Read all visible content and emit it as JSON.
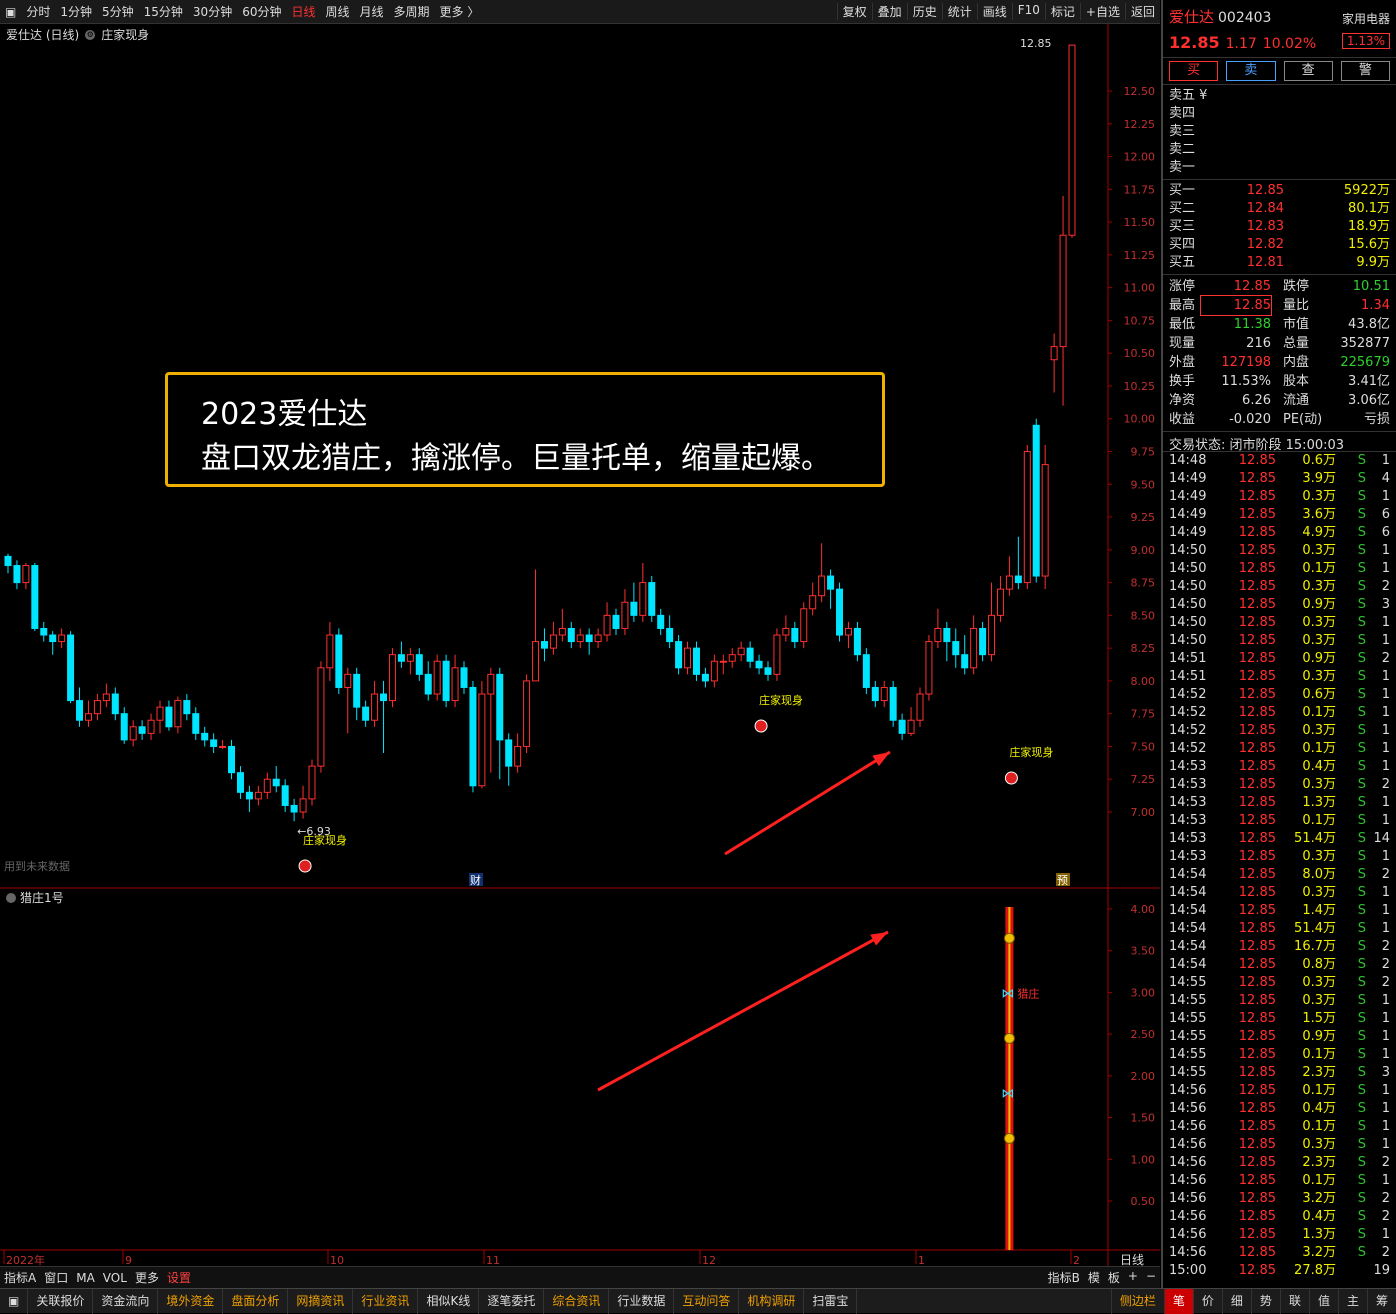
{
  "toolbar": {
    "items": [
      "分时",
      "1分钟",
      "5分钟",
      "15分钟",
      "30分钟",
      "60分钟",
      "日线",
      "周线",
      "月线",
      "多周期",
      "更多 〉"
    ],
    "right": [
      "复权",
      "叠加",
      "历史",
      "统计",
      "画线",
      "F10",
      "标记",
      "+自选",
      "返回"
    ]
  },
  "legend": {
    "title": "爱仕达 (日线)",
    "indicator": "庄家现身"
  },
  "annotation": {
    "line1": "2023爱仕达",
    "line2": "盘口双龙猎庄，擒涨停。巨量托单，缩量起爆。"
  },
  "price_axis": [
    "12.50",
    "12.25",
    "12.00",
    "11.75",
    "11.50",
    "11.25",
    "11.00",
    "10.75",
    "10.50",
    "10.25",
    "10.00",
    "9.75",
    "9.50",
    "9.25",
    "9.00",
    "8.75",
    "8.50",
    "8.25",
    "8.00",
    "7.75",
    "7.50",
    "7.25",
    "7.00"
  ],
  "ind_axis": [
    "4.00",
    "3.50",
    "3.00",
    "2.50",
    "2.00",
    "1.50",
    "1.00",
    "0.50"
  ],
  "date_axis": [
    "2022年",
    "9",
    "10",
    "11",
    "12",
    "1",
    "2"
  ],
  "period_label": "日线",
  "marks": {
    "high": "12.85",
    "low": "←6.93",
    "zhuang": "庄家现身",
    "future": "用到未来数据",
    "cai": "财",
    "yu": "预",
    "liezhuang": "猎庄"
  },
  "sub_legend": "猎庄1号",
  "bottom": {
    "left": [
      "指标A",
      "窗口",
      "MA",
      "VOL",
      "更多"
    ],
    "settings": "设置",
    "right": [
      "指标B",
      "模",
      "板",
      "+",
      "−"
    ]
  },
  "taskbar": {
    "items": [
      "关联报价",
      "资金流向",
      "境外资金",
      "盘面分析",
      "网摘资讯",
      "行业资讯",
      "相似K线",
      "逐笔委托",
      "综合资讯",
      "行业数据",
      "互动问答",
      "机构调研",
      "扫雷宝"
    ],
    "gold": [
      2,
      3,
      4,
      5,
      8,
      10,
      11
    ],
    "side": "侧边栏",
    "tabs": [
      "笔",
      "价",
      "细",
      "势",
      "联",
      "值",
      "主",
      "筹"
    ]
  },
  "stock": {
    "name": "爱仕达",
    "code": "002403",
    "industry": "家用电器",
    "price": "12.85",
    "change": "1.17",
    "pct": "10.02%",
    "tag": "1.13%"
  },
  "buttons": [
    "买",
    "卖",
    "查",
    "警"
  ],
  "asks": [
    [
      "卖五 ¥",
      "",
      ""
    ],
    [
      "卖四",
      "",
      ""
    ],
    [
      "卖三",
      "",
      ""
    ],
    [
      "卖二",
      "",
      ""
    ],
    [
      "卖一",
      "",
      ""
    ]
  ],
  "bids": [
    [
      "买一",
      "12.85",
      "5922万"
    ],
    [
      "买二",
      "12.84",
      "80.1万"
    ],
    [
      "买三",
      "12.83",
      "18.9万"
    ],
    [
      "买四",
      "12.82",
      "15.6万"
    ],
    [
      "买五",
      "12.81",
      "9.9万"
    ]
  ],
  "stats": [
    [
      "涨停",
      "12.85",
      "跌停",
      "10.51"
    ],
    [
      "最高",
      "12.85",
      "量比",
      "1.34"
    ],
    [
      "最低",
      "11.38",
      "市值",
      "43.8亿"
    ],
    [
      "现量",
      "216",
      "总量",
      "352877"
    ],
    [
      "外盘",
      "127198",
      "内盘",
      "225679"
    ],
    [
      "换手",
      "11.53%",
      "股本",
      "3.41亿"
    ],
    [
      "净资",
      "6.26",
      "流通",
      "3.06亿"
    ],
    [
      "收益",
      "-0.020",
      "PE(动)",
      "亏损"
    ]
  ],
  "state": "交易状态: 闭市阶段 15:00:03",
  "ticks": [
    [
      "14:48",
      "12.85",
      "0.6万",
      "S",
      "1"
    ],
    [
      "14:49",
      "12.85",
      "3.9万",
      "S",
      "4"
    ],
    [
      "14:49",
      "12.85",
      "0.3万",
      "S",
      "1"
    ],
    [
      "14:49",
      "12.85",
      "3.6万",
      "S",
      "6"
    ],
    [
      "14:49",
      "12.85",
      "4.9万",
      "S",
      "6"
    ],
    [
      "14:50",
      "12.85",
      "0.3万",
      "S",
      "1"
    ],
    [
      "14:50",
      "12.85",
      "0.1万",
      "S",
      "1"
    ],
    [
      "14:50",
      "12.85",
      "0.3万",
      "S",
      "2"
    ],
    [
      "14:50",
      "12.85",
      "0.9万",
      "S",
      "3"
    ],
    [
      "14:50",
      "12.85",
      "0.3万",
      "S",
      "1"
    ],
    [
      "14:50",
      "12.85",
      "0.3万",
      "S",
      "1"
    ],
    [
      "14:51",
      "12.85",
      "0.9万",
      "S",
      "2"
    ],
    [
      "14:51",
      "12.85",
      "0.3万",
      "S",
      "1"
    ],
    [
      "14:52",
      "12.85",
      "0.6万",
      "S",
      "1"
    ],
    [
      "14:52",
      "12.85",
      "0.1万",
      "S",
      "1"
    ],
    [
      "14:52",
      "12.85",
      "0.3万",
      "S",
      "1"
    ],
    [
      "14:52",
      "12.85",
      "0.1万",
      "S",
      "1"
    ],
    [
      "14:53",
      "12.85",
      "0.4万",
      "S",
      "1"
    ],
    [
      "14:53",
      "12.85",
      "0.3万",
      "S",
      "2"
    ],
    [
      "14:53",
      "12.85",
      "1.3万",
      "S",
      "1"
    ],
    [
      "14:53",
      "12.85",
      "0.1万",
      "S",
      "1"
    ],
    [
      "14:53",
      "12.85",
      "51.4万",
      "S",
      "14"
    ],
    [
      "14:53",
      "12.85",
      "0.3万",
      "S",
      "1"
    ],
    [
      "14:54",
      "12.85",
      "8.0万",
      "S",
      "2"
    ],
    [
      "14:54",
      "12.85",
      "0.3万",
      "S",
      "1"
    ],
    [
      "14:54",
      "12.85",
      "1.4万",
      "S",
      "1"
    ],
    [
      "14:54",
      "12.85",
      "51.4万",
      "S",
      "1"
    ],
    [
      "14:54",
      "12.85",
      "16.7万",
      "S",
      "2"
    ],
    [
      "14:54",
      "12.85",
      "0.8万",
      "S",
      "2"
    ],
    [
      "14:55",
      "12.85",
      "0.3万",
      "S",
      "2"
    ],
    [
      "14:55",
      "12.85",
      "0.3万",
      "S",
      "1"
    ],
    [
      "14:55",
      "12.85",
      "1.5万",
      "S",
      "1"
    ],
    [
      "14:55",
      "12.85",
      "0.9万",
      "S",
      "1"
    ],
    [
      "14:55",
      "12.85",
      "0.1万",
      "S",
      "1"
    ],
    [
      "14:55",
      "12.85",
      "2.3万",
      "S",
      "3"
    ],
    [
      "14:56",
      "12.85",
      "0.1万",
      "S",
      "1"
    ],
    [
      "14:56",
      "12.85",
      "0.4万",
      "S",
      "1"
    ],
    [
      "14:56",
      "12.85",
      "0.1万",
      "S",
      "1"
    ],
    [
      "14:56",
      "12.85",
      "0.3万",
      "S",
      "1"
    ],
    [
      "14:56",
      "12.85",
      "2.3万",
      "S",
      "2"
    ],
    [
      "14:56",
      "12.85",
      "0.1万",
      "S",
      "1"
    ],
    [
      "14:56",
      "12.85",
      "3.2万",
      "S",
      "2"
    ],
    [
      "14:56",
      "12.85",
      "0.4万",
      "S",
      "2"
    ],
    [
      "14:56",
      "12.85",
      "1.3万",
      "S",
      "1"
    ],
    [
      "14:56",
      "12.85",
      "3.2万",
      "S",
      "2"
    ],
    [
      "15:00",
      "12.85",
      "27.8万",
      "",
      "19"
    ]
  ],
  "chart_data": {
    "type": "candlestick",
    "candles": [
      [
        8.95,
        8.88,
        8.97,
        8.82
      ],
      [
        8.88,
        8.75,
        8.92,
        8.7
      ],
      [
        8.75,
        8.88,
        8.9,
        8.7
      ],
      [
        8.88,
        8.4,
        8.9,
        8.38
      ],
      [
        8.4,
        8.35,
        8.45,
        8.3
      ],
      [
        8.35,
        8.3,
        8.38,
        8.2
      ],
      [
        8.3,
        8.35,
        8.4,
        8.25
      ],
      [
        8.35,
        7.85,
        8.38,
        7.83
      ],
      [
        7.85,
        7.7,
        7.95,
        7.65
      ],
      [
        7.7,
        7.75,
        7.85,
        7.65
      ],
      [
        7.75,
        7.85,
        7.9,
        7.7
      ],
      [
        7.85,
        7.9,
        7.98,
        7.8
      ],
      [
        7.9,
        7.75,
        7.95,
        7.7
      ],
      [
        7.75,
        7.55,
        7.8,
        7.52
      ],
      [
        7.55,
        7.65,
        7.7,
        7.5
      ],
      [
        7.65,
        7.6,
        7.7,
        7.55
      ],
      [
        7.6,
        7.7,
        7.75,
        7.55
      ],
      [
        7.7,
        7.8,
        7.85,
        7.6
      ],
      [
        7.8,
        7.65,
        7.85,
        7.62
      ],
      [
        7.65,
        7.85,
        7.88,
        7.6
      ],
      [
        7.85,
        7.75,
        7.9,
        7.7
      ],
      [
        7.75,
        7.6,
        7.8,
        7.55
      ],
      [
        7.6,
        7.55,
        7.65,
        7.5
      ],
      [
        7.55,
        7.5,
        7.6,
        7.45
      ],
      [
        7.5,
        7.5,
        7.55,
        7.48
      ],
      [
        7.5,
        7.3,
        7.55,
        7.25
      ],
      [
        7.3,
        7.15,
        7.35,
        7.1
      ],
      [
        7.15,
        7.1,
        7.2,
        7.0
      ],
      [
        7.1,
        7.15,
        7.2,
        7.05
      ],
      [
        7.15,
        7.25,
        7.3,
        7.1
      ],
      [
        7.25,
        7.2,
        7.35,
        7.15
      ],
      [
        7.2,
        7.05,
        7.25,
        7.0
      ],
      [
        7.05,
        7.0,
        7.1,
        6.93
      ],
      [
        7.0,
        7.1,
        7.2,
        6.95
      ],
      [
        7.1,
        7.35,
        7.4,
        7.05
      ],
      [
        7.35,
        8.1,
        8.15,
        7.3
      ],
      [
        8.1,
        8.35,
        8.45,
        8.0
      ],
      [
        8.35,
        7.95,
        8.4,
        7.9
      ],
      [
        7.95,
        8.05,
        8.1,
        7.6
      ],
      [
        8.05,
        7.8,
        8.1,
        7.7
      ],
      [
        7.8,
        7.7,
        7.85,
        7.65
      ],
      [
        7.7,
        7.9,
        8.0,
        7.65
      ],
      [
        7.9,
        7.85,
        8.0,
        7.45
      ],
      [
        7.85,
        8.2,
        8.25,
        7.8
      ],
      [
        8.2,
        8.15,
        8.3,
        8.1
      ],
      [
        8.15,
        8.2,
        8.25,
        8.05
      ],
      [
        8.2,
        8.05,
        8.25,
        8.0
      ],
      [
        8.05,
        7.9,
        8.15,
        7.85
      ],
      [
        7.9,
        8.15,
        8.2,
        7.85
      ],
      [
        8.15,
        7.85,
        8.2,
        7.8
      ],
      [
        7.85,
        8.1,
        8.2,
        7.8
      ],
      [
        8.1,
        7.95,
        8.15,
        7.9
      ],
      [
        7.95,
        7.2,
        8.0,
        7.15
      ],
      [
        7.2,
        7.9,
        8.0,
        7.18
      ],
      [
        7.9,
        8.05,
        8.1,
        7.3
      ],
      [
        8.05,
        7.55,
        8.1,
        7.25
      ],
      [
        7.55,
        7.35,
        7.6,
        7.2
      ],
      [
        7.35,
        7.5,
        7.6,
        7.3
      ],
      [
        7.5,
        8.0,
        8.05,
        7.45
      ],
      [
        8.0,
        8.3,
        8.85,
        8.2
      ],
      [
        8.3,
        8.25,
        8.4,
        8.15
      ],
      [
        8.25,
        8.35,
        8.45,
        8.2
      ],
      [
        8.35,
        8.4,
        8.55,
        8.3
      ],
      [
        8.4,
        8.3,
        8.45,
        8.25
      ],
      [
        8.3,
        8.35,
        8.4,
        8.25
      ],
      [
        8.35,
        8.3,
        8.4,
        8.2
      ],
      [
        8.3,
        8.35,
        8.4,
        8.25
      ],
      [
        8.35,
        8.5,
        8.6,
        8.3
      ],
      [
        8.5,
        8.4,
        8.55,
        8.35
      ],
      [
        8.4,
        8.6,
        8.7,
        8.35
      ],
      [
        8.6,
        8.5,
        8.75,
        8.45
      ],
      [
        8.5,
        8.75,
        8.9,
        8.45
      ],
      [
        8.75,
        8.5,
        8.8,
        8.45
      ],
      [
        8.5,
        8.4,
        8.55,
        8.35
      ],
      [
        8.4,
        8.3,
        8.5,
        8.25
      ],
      [
        8.3,
        8.1,
        8.35,
        8.05
      ],
      [
        8.1,
        8.25,
        8.3,
        8.05
      ],
      [
        8.25,
        8.05,
        8.3,
        8.0
      ],
      [
        8.05,
        8.0,
        8.1,
        7.95
      ],
      [
        8.0,
        8.15,
        8.2,
        7.95
      ],
      [
        8.15,
        8.15,
        8.2,
        8.05
      ],
      [
        8.15,
        8.2,
        8.25,
        8.1
      ],
      [
        8.2,
        8.25,
        8.3,
        8.15
      ],
      [
        8.25,
        8.15,
        8.3,
        8.1
      ],
      [
        8.15,
        8.1,
        8.2,
        8.05
      ],
      [
        8.1,
        8.05,
        8.15,
        8.0
      ],
      [
        8.05,
        8.35,
        8.4,
        8.0
      ],
      [
        8.35,
        8.4,
        8.5,
        8.3
      ],
      [
        8.4,
        8.3,
        8.45,
        8.25
      ],
      [
        8.3,
        8.55,
        8.6,
        8.25
      ],
      [
        8.55,
        8.65,
        8.75,
        8.5
      ],
      [
        8.65,
        8.8,
        9.05,
        8.6
      ],
      [
        8.8,
        8.7,
        8.85,
        8.55
      ],
      [
        8.7,
        8.35,
        8.75,
        8.3
      ],
      [
        8.35,
        8.4,
        8.45,
        8.25
      ],
      [
        8.4,
        8.2,
        8.45,
        8.15
      ],
      [
        8.2,
        7.95,
        8.25,
        7.9
      ],
      [
        7.95,
        7.85,
        8.0,
        7.8
      ],
      [
        7.85,
        7.95,
        8.0,
        7.8
      ],
      [
        7.95,
        7.7,
        8.0,
        7.65
      ],
      [
        7.7,
        7.6,
        7.75,
        7.55
      ],
      [
        7.6,
        7.7,
        7.8,
        7.58
      ],
      [
        7.7,
        7.9,
        7.95,
        7.65
      ],
      [
        7.9,
        8.3,
        8.35,
        7.85
      ],
      [
        8.3,
        8.4,
        8.55,
        8.25
      ],
      [
        8.4,
        8.3,
        8.45,
        8.15
      ],
      [
        8.3,
        8.2,
        8.4,
        8.1
      ],
      [
        8.2,
        8.1,
        8.35,
        8.05
      ],
      [
        8.1,
        8.4,
        8.5,
        8.05
      ],
      [
        8.4,
        8.2,
        8.45,
        8.15
      ],
      [
        8.2,
        8.5,
        8.75,
        8.15
      ],
      [
        8.5,
        8.7,
        8.8,
        8.45
      ],
      [
        8.7,
        8.8,
        8.95,
        8.65
      ],
      [
        8.8,
        8.75,
        9.1,
        8.7
      ],
      [
        8.75,
        9.75,
        9.8,
        8.7
      ],
      [
        9.95,
        8.8,
        10.0,
        8.75
      ],
      [
        8.8,
        9.65,
        9.8,
        8.7
      ],
      [
        10.45,
        10.55,
        10.65,
        10.2
      ],
      [
        10.55,
        11.4,
        11.7,
        10.1
      ],
      [
        11.4,
        12.85,
        12.85,
        11.38
      ]
    ],
    "zhuang_signals": [
      33,
      84,
      112
    ],
    "indicator": {
      "name": "猎庄1号",
      "bar_index": 112,
      "range": [
        0,
        4.0
      ]
    }
  }
}
